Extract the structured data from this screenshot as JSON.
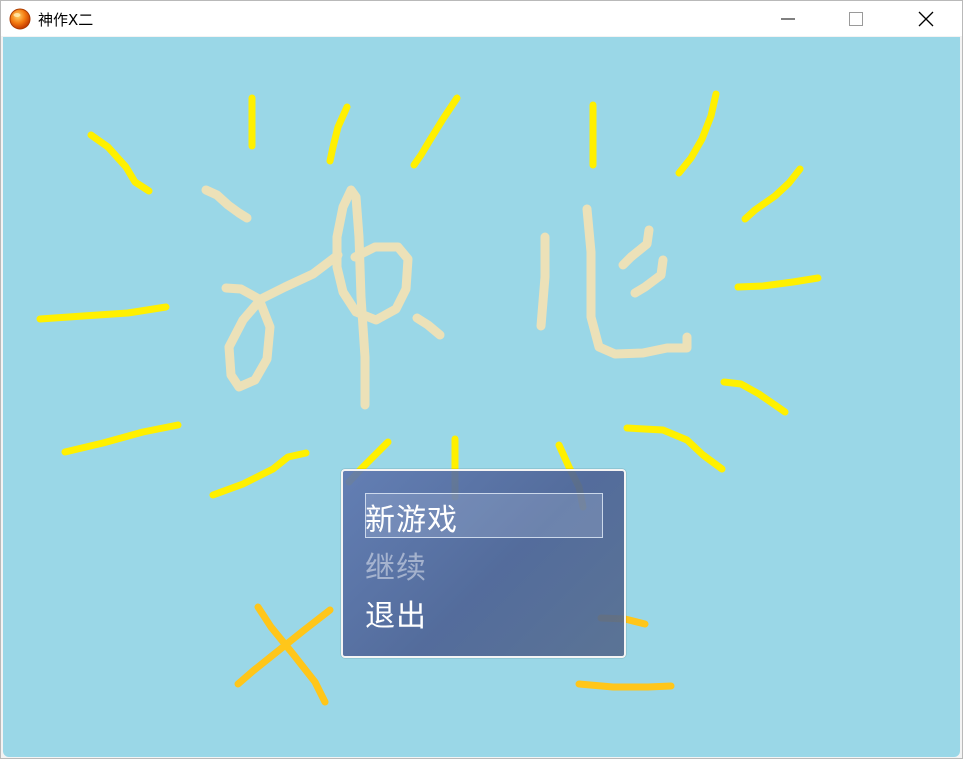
{
  "window": {
    "title": "神作X二",
    "icon": "orange-sun-icon",
    "controls": [
      "minimize-icon",
      "maximize-icon",
      "close-icon"
    ]
  },
  "game": {
    "background_color": "#9ad7e7",
    "logo_color": "#ece1b8",
    "ray_color": "#fff000",
    "accent_ray_color": "#ffc61a"
  },
  "menu": {
    "items": [
      {
        "label": "新游戏",
        "enabled": true,
        "selected": true
      },
      {
        "label": "继续",
        "enabled": false,
        "selected": false
      },
      {
        "label": "退出",
        "enabled": true,
        "selected": false
      }
    ]
  }
}
